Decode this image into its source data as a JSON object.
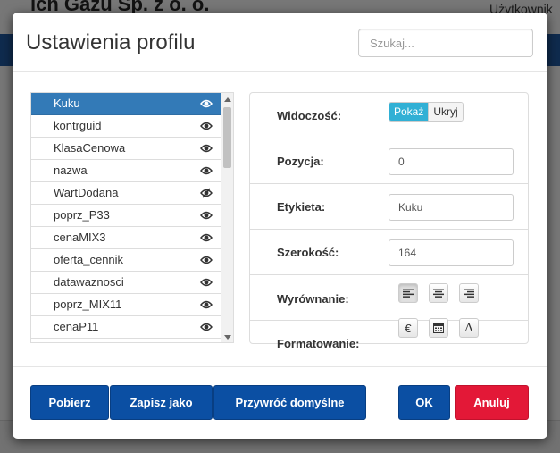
{
  "background": {
    "company_title": "ıch Gazu Sp. z o. o.",
    "user_label": "Użytkownik"
  },
  "modal": {
    "title": "Ustawienia profilu",
    "search_placeholder": "Szukaj..."
  },
  "fields": [
    {
      "label": "Kuku",
      "visible": true,
      "selected": true
    },
    {
      "label": "kontrguid",
      "visible": true,
      "selected": false
    },
    {
      "label": "KlasaCenowa",
      "visible": true,
      "selected": false
    },
    {
      "label": "nazwa",
      "visible": true,
      "selected": false
    },
    {
      "label": "WartDodana",
      "visible": false,
      "selected": false
    },
    {
      "label": "poprz_P33",
      "visible": true,
      "selected": false
    },
    {
      "label": "cenaMIX3",
      "visible": true,
      "selected": false
    },
    {
      "label": "oferta_cennik",
      "visible": true,
      "selected": false
    },
    {
      "label": "datawaznosci",
      "visible": true,
      "selected": false
    },
    {
      "label": "poprz_MIX11",
      "visible": true,
      "selected": false
    },
    {
      "label": "cenaP11",
      "visible": true,
      "selected": false
    },
    {
      "label": "",
      "visible": true,
      "selected": false
    }
  ],
  "properties": {
    "visibility": {
      "label": "Widoczość:",
      "show": "Pokaż",
      "hide": "Ukryj",
      "value": "Pokaż"
    },
    "position": {
      "label": "Pozycja:",
      "value": "0"
    },
    "caption": {
      "label": "Etykieta:",
      "value": "Kuku"
    },
    "width": {
      "label": "Szerokość:",
      "value": "164"
    },
    "alignment": {
      "label": "Wyrównanie:",
      "options": [
        "align-left-icon",
        "align-center-icon",
        "align-right-icon"
      ],
      "selected": "align-left-icon"
    },
    "formatting": {
      "label": "Formatowanie:",
      "options": [
        "euro-icon",
        "calendar-icon",
        "text-format-icon"
      ]
    }
  },
  "footer": {
    "fetch": "Pobierz",
    "save_as": "Zapisz jako",
    "restore_defaults": "Przywróć domyślne",
    "ok": "OK",
    "cancel": "Anuluj"
  },
  "colors": {
    "primary": "#0b4fa3",
    "danger": "#e31837",
    "selected_row": "#337ab7",
    "toggle_active": "#31b0d5"
  }
}
